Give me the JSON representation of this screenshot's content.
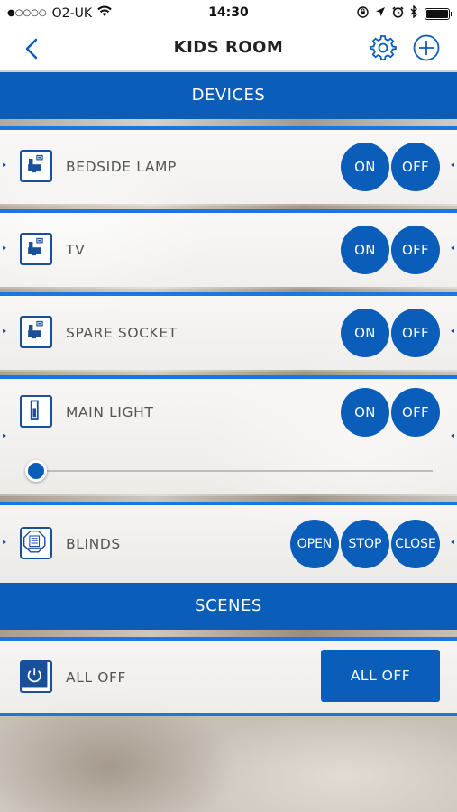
{
  "status_bar": {
    "signal_dots": "●○○○○",
    "carrier": "O2-UK",
    "time": "14:30"
  },
  "nav": {
    "title": "KIDS ROOM"
  },
  "sections": {
    "devices": "DEVICES",
    "scenes": "SCENES"
  },
  "devices": [
    {
      "label": "BEDSIDE LAMP",
      "icon": "socket-icon",
      "on": "ON",
      "off": "OFF"
    },
    {
      "label": "TV",
      "icon": "socket-icon",
      "on": "ON",
      "off": "OFF"
    },
    {
      "label": "SPARE SOCKET",
      "icon": "socket-icon",
      "on": "ON",
      "off": "OFF"
    },
    {
      "label": "MAIN LIGHT",
      "icon": "light-switch-icon",
      "on": "ON",
      "off": "OFF",
      "dimmer_level": 0
    },
    {
      "label": "BLINDS",
      "icon": "blinds-controller-icon",
      "open": "OPEN",
      "stop": "STOP",
      "close": "CLOSE"
    }
  ],
  "scenes": [
    {
      "label": "ALL OFF",
      "icon": "power-icon",
      "button": "ALL OFF"
    }
  ],
  "colors": {
    "accent": "#0a5db8",
    "row_border": "#1a77e0",
    "icon_border": "#1a4f9a"
  }
}
